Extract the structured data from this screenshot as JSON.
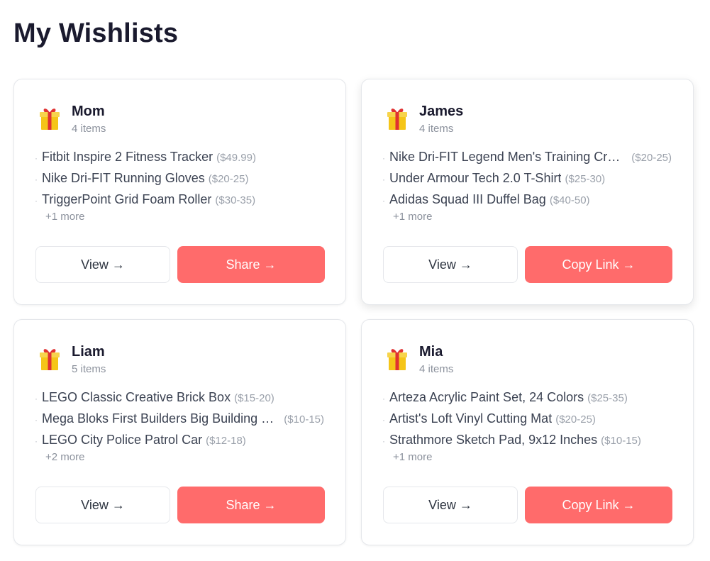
{
  "page": {
    "title": "My Wishlists"
  },
  "colors": {
    "accent": "#ff6b6b",
    "gift_box": "#f5c518",
    "gift_ribbon": "#e03131"
  },
  "cards": [
    {
      "name": "Mom",
      "count": "4 items",
      "icon": "gift-icon",
      "items": [
        {
          "name": "Fitbit Inspire 2 Fitness Tracker",
          "price": "($49.99)"
        },
        {
          "name": "Nike Dri-FIT Running Gloves",
          "price": "($20-25)"
        },
        {
          "name": "TriggerPoint Grid Foam Roller",
          "price": "($30-35)"
        }
      ],
      "more": "+1 more",
      "view_label": "View →",
      "action_label": "Share →"
    },
    {
      "name": "James",
      "count": "4 items",
      "icon": "gift-icon",
      "items": [
        {
          "name": "Nike Dri-FIT Legend Men's Training Crew",
          "price": "($20-25)"
        },
        {
          "name": "Under Armour Tech 2.0 T-Shirt",
          "price": "($25-30)"
        },
        {
          "name": "Adidas Squad III Duffel Bag",
          "price": "($40-50)"
        }
      ],
      "more": "+1 more",
      "view_label": "View →",
      "action_label": "Copy Link →"
    },
    {
      "name": "Liam",
      "count": "5 items",
      "icon": "gift-icon",
      "items": [
        {
          "name": "LEGO Classic Creative Brick Box",
          "price": "($15-20)"
        },
        {
          "name": "Mega Bloks First Builders Big Building Bag",
          "price": "($10-15)"
        },
        {
          "name": "LEGO City Police Patrol Car",
          "price": "($12-18)"
        }
      ],
      "more": "+2 more",
      "view_label": "View →",
      "action_label": "Share →"
    },
    {
      "name": "Mia",
      "count": "4 items",
      "icon": "gift-icon",
      "items": [
        {
          "name": "Arteza Acrylic Paint Set, 24 Colors",
          "price": "($25-35)"
        },
        {
          "name": "Artist's Loft Vinyl Cutting Mat",
          "price": "($20-25)"
        },
        {
          "name": "Strathmore Sketch Pad, 9x12 Inches",
          "price": "($10-15)"
        }
      ],
      "more": "+1 more",
      "view_label": "View →",
      "action_label": "Copy Link →"
    }
  ]
}
